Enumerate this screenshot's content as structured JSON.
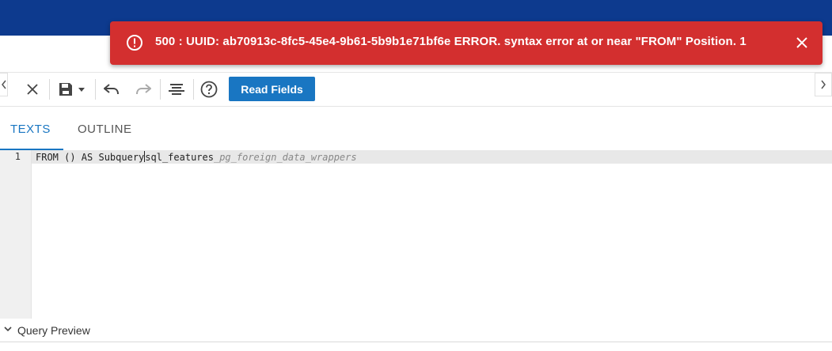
{
  "toast": {
    "message": "500 : UUID: ab70913c-8fc5-45e4-9b61-5b9b1e71bf6e ERROR. syntax error at or near \"FROM\" Position. 1",
    "background": "#d32f2f"
  },
  "colors": {
    "header": "#0d3a8e",
    "accent": "#1976c2"
  },
  "toolbar": {
    "read_fields_label": "Read Fields",
    "icons": [
      "close-icon",
      "save-icon",
      "dropdown-caret-icon",
      "undo-icon",
      "redo-icon",
      "format-icon",
      "help-icon"
    ]
  },
  "tabs": [
    {
      "label": "TEXTS",
      "active": true
    },
    {
      "label": "OUTLINE",
      "active": false
    }
  ],
  "editor": {
    "line_number": "1",
    "code_before_caret": "FROM () AS Subquery",
    "code_after_caret": "sql_features",
    "ghost_suggestion": "_pg_foreign_data_wrappers"
  },
  "preview": {
    "label": "Query Preview"
  }
}
